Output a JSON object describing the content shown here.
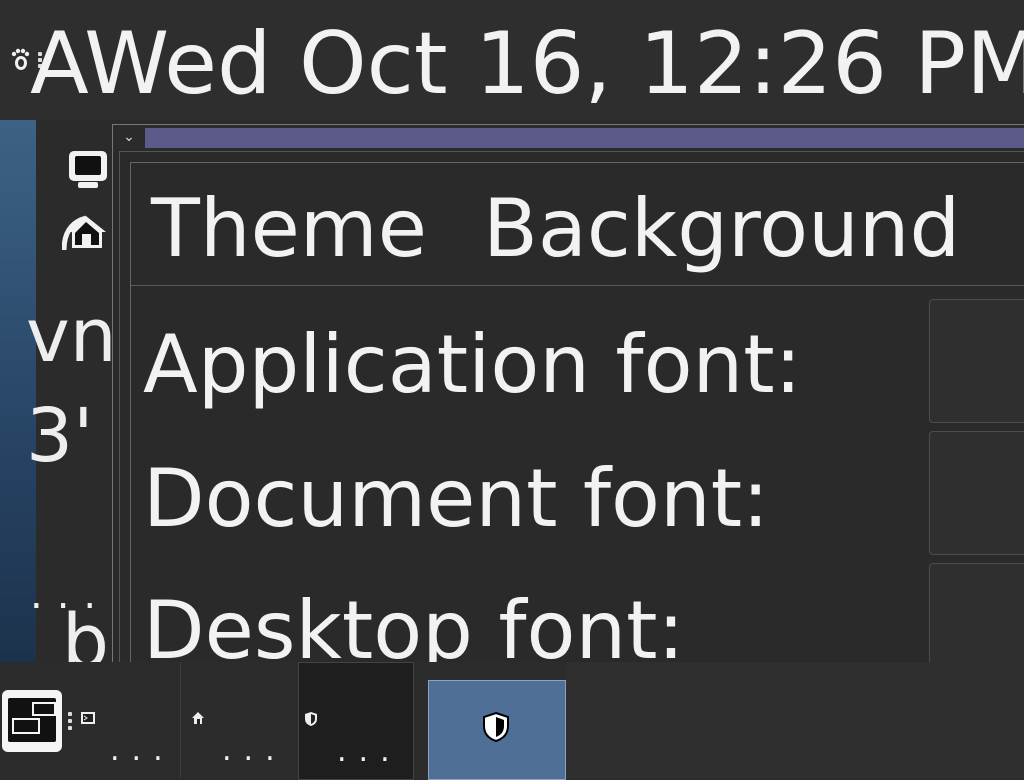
{
  "top_panel": {
    "apps_icon": "gnome-foot-icon",
    "clock": "AWed Oct 16, 12:26 PM"
  },
  "desktop": {
    "icons": [
      "computer-icon",
      "home-icon"
    ],
    "label_line1": "vn",
    "label_line2": "3'",
    "label_dots": "...",
    "label_line3": "b"
  },
  "window": {
    "menu_glyph": "⌄",
    "tabs": [
      {
        "label": "Theme"
      },
      {
        "label": "Background"
      }
    ],
    "rows": [
      {
        "label": "Application font:"
      },
      {
        "label": "Document font:"
      },
      {
        "label": "Desktop font:"
      }
    ]
  },
  "taskbar": {
    "task_dots": "...",
    "colors": {
      "active_task": "#4f6f96",
      "title_accent": "#5b5a8a"
    }
  }
}
